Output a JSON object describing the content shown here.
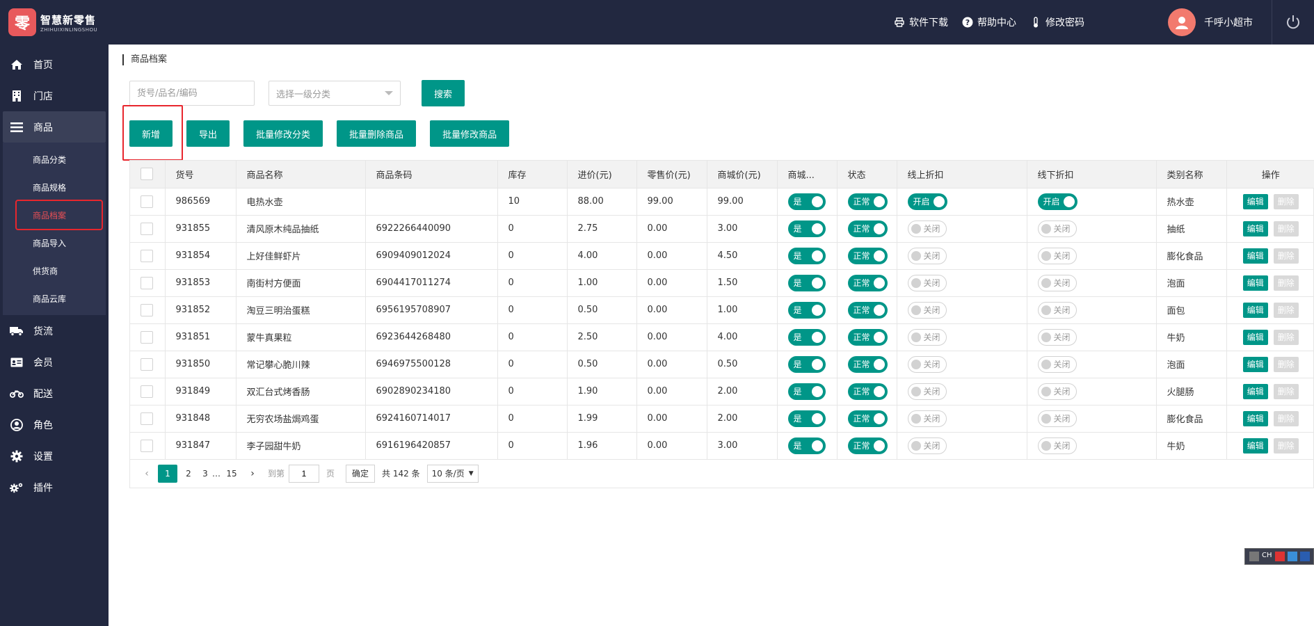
{
  "brand": {
    "logo_char": "零",
    "name_cn": "智慧新零售",
    "name_en": "ZHIHUIXINLINGSHOU",
    "color": "#e8595c"
  },
  "header": {
    "links": [
      {
        "label": "软件下载",
        "icon": "printer-icon"
      },
      {
        "label": "帮助中心",
        "icon": "help-icon"
      },
      {
        "label": "修改密码",
        "icon": "thermometer-icon"
      }
    ],
    "user": "千呼小超市"
  },
  "sidebar": {
    "items": [
      {
        "label": "首页",
        "icon": "home-icon"
      },
      {
        "label": "门店",
        "icon": "building-icon"
      },
      {
        "label": "商品",
        "icon": "menu-icon"
      },
      {
        "label": "货流",
        "icon": "truck-icon"
      },
      {
        "label": "会员",
        "icon": "id-card-icon"
      },
      {
        "label": "配送",
        "icon": "motorcycle-icon"
      },
      {
        "label": "角色",
        "icon": "user-circle-icon"
      },
      {
        "label": "设置",
        "icon": "gear-icon"
      },
      {
        "label": "插件",
        "icon": "gears-icon"
      }
    ],
    "sub_items": [
      "商品分类",
      "商品规格",
      "商品档案",
      "商品导入",
      "供货商",
      "商品云库"
    ]
  },
  "breadcrumb": "商品档案",
  "search": {
    "placeholder": "货号/品名/编码",
    "category_placeholder": "选择一级分类",
    "button": "搜索"
  },
  "actions": [
    "新增",
    "导出",
    "批量修改分类",
    "批量删除商品",
    "批量修改商品"
  ],
  "table": {
    "columns": [
      "货号",
      "商品名称",
      "商品条码",
      "库存",
      "进价(元)",
      "零售价(元)",
      "商城价(元)",
      "商城...",
      "状态",
      "线上折扣",
      "线下折扣",
      "类别名称",
      "操作"
    ],
    "rows": [
      {
        "code": "986569",
        "name": "电热水壶",
        "barcode": "",
        "stock": "10",
        "cost": "88.00",
        "retail": "99.00",
        "mall": "99.00",
        "online": "开启",
        "offline": "开启",
        "category": "热水壶"
      },
      {
        "code": "931855",
        "name": "清风原木纯品抽纸",
        "barcode": "6922266440090",
        "stock": "0",
        "cost": "2.75",
        "retail": "0.00",
        "mall": "3.00",
        "online": "关闭",
        "offline": "关闭",
        "category": "抽纸"
      },
      {
        "code": "931854",
        "name": "上好佳鲜虾片",
        "barcode": "6909409012024",
        "stock": "0",
        "cost": "4.00",
        "retail": "0.00",
        "mall": "4.50",
        "online": "关闭",
        "offline": "关闭",
        "category": "膨化食品"
      },
      {
        "code": "931853",
        "name": "南街村方便面",
        "barcode": "6904417011274",
        "stock": "0",
        "cost": "1.00",
        "retail": "0.00",
        "mall": "1.50",
        "online": "关闭",
        "offline": "关闭",
        "category": "泡面"
      },
      {
        "code": "931852",
        "name": "淘豆三明治蛋糕",
        "barcode": "6956195708907",
        "stock": "0",
        "cost": "0.50",
        "retail": "0.00",
        "mall": "1.00",
        "online": "关闭",
        "offline": "关闭",
        "category": "面包"
      },
      {
        "code": "931851",
        "name": "蒙牛真果粒",
        "barcode": "6923644268480",
        "stock": "0",
        "cost": "2.50",
        "retail": "0.00",
        "mall": "4.00",
        "online": "关闭",
        "offline": "关闭",
        "category": "牛奶"
      },
      {
        "code": "931850",
        "name": "常记攀心脆川辣",
        "barcode": "6946975500128",
        "stock": "0",
        "cost": "0.50",
        "retail": "0.00",
        "mall": "0.50",
        "online": "关闭",
        "offline": "关闭",
        "category": "泡面"
      },
      {
        "code": "931849",
        "name": "双汇台式烤香肠",
        "barcode": "6902890234180",
        "stock": "0",
        "cost": "1.90",
        "retail": "0.00",
        "mall": "2.00",
        "online": "关闭",
        "offline": "关闭",
        "category": "火腿肠"
      },
      {
        "code": "931848",
        "name": "无穷农场盐焗鸡蛋",
        "barcode": "6924160714017",
        "stock": "0",
        "cost": "1.99",
        "retail": "0.00",
        "mall": "2.00",
        "online": "关闭",
        "offline": "关闭",
        "category": "膨化食品"
      },
      {
        "code": "931847",
        "name": "李子园甜牛奶",
        "barcode": "6916196420857",
        "stock": "0",
        "cost": "1.96",
        "retail": "0.00",
        "mall": "3.00",
        "online": "关闭",
        "offline": "关闭",
        "category": "牛奶"
      }
    ],
    "mall_label": "是",
    "status_label": "正常",
    "edit_label": "编辑",
    "delete_label": "删除"
  },
  "pagination": {
    "pages": [
      "1",
      "2",
      "3",
      "…",
      "15"
    ],
    "goto_prefix": "到第",
    "goto_value": "1",
    "goto_suffix": "页",
    "confirm": "确定",
    "total": "共 142 条",
    "page_size": "10 条/页"
  },
  "tray": {
    "lang": "CH"
  },
  "colors": {
    "primary": "#009688",
    "sidebar_bg": "#222840",
    "highlight": "#e8262d"
  }
}
